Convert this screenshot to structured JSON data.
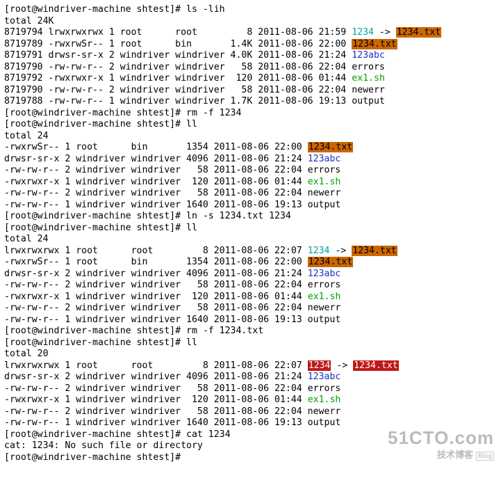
{
  "corner_tl": "┌",
  "corner_bl": "└",
  "prompt1": "[root@windriver-machine shtest]# ls -lih",
  "total1": "total 24K",
  "block1": [
    {
      "inode": "8719794",
      "perm": "lrwxrwxrwx",
      "n": "1",
      "u": "root     ",
      "g": "root     ",
      "size": "   8",
      "date": "2011-08-06 21:59",
      "name": "1234",
      "type": "link",
      "arrow": " -> ",
      "target": "1234.txt",
      "target_type": "hl-orange"
    },
    {
      "inode": "8719789",
      "perm": "-rwxrwSr--",
      "n": "1",
      "u": "root     ",
      "g": "bin      ",
      "size": "1.4K",
      "date": "2011-08-06 22:00",
      "name": "1234.txt",
      "type": "hl-orange"
    },
    {
      "inode": "8719791",
      "perm": "drwsr-sr-x",
      "n": "2",
      "u": "windriver",
      "g": "windriver",
      "size": "4.0K",
      "date": "2011-08-06 21:24",
      "name": "123abc",
      "type": "blue"
    },
    {
      "inode": "8719790",
      "perm": "-rw-rw-r--",
      "n": "2",
      "u": "windriver",
      "g": "windriver",
      "size": "  58",
      "date": "2011-08-06 22:04",
      "name": "errors",
      "type": "plain"
    },
    {
      "inode": "8719792",
      "perm": "-rwxrwxr-x",
      "n": "1",
      "u": "windriver",
      "g": "windriver",
      "size": " 120",
      "date": "2011-08-06 01:44",
      "name": "ex1.sh",
      "type": "green"
    },
    {
      "inode": "8719790",
      "perm": "-rw-rw-r--",
      "n": "2",
      "u": "windriver",
      "g": "windriver",
      "size": "  58",
      "date": "2011-08-06 22:04",
      "name": "newerr",
      "type": "plain"
    },
    {
      "inode": "8719788",
      "perm": "-rw-rw-r--",
      "n": "1",
      "u": "windriver",
      "g": "windriver",
      "size": "1.7K",
      "date": "2011-08-06 19:13",
      "name": "output",
      "type": "plain"
    }
  ],
  "prompt2": "[root@windriver-machine shtest]# rm -f 1234",
  "prompt3": "[root@windriver-machine shtest]# ll",
  "total2": "total 24",
  "block2": [
    {
      "perm": "-rwxrwSr--",
      "n": "1",
      "u": "root     ",
      "g": "bin      ",
      "size": "1354",
      "date": "2011-08-06 22:00",
      "name": "1234.txt",
      "type": "hl-orange"
    },
    {
      "perm": "drwsr-sr-x",
      "n": "2",
      "u": "windriver",
      "g": "windriver",
      "size": "4096",
      "date": "2011-08-06 21:24",
      "name": "123abc",
      "type": "blue"
    },
    {
      "perm": "-rw-rw-r--",
      "n": "2",
      "u": "windriver",
      "g": "windriver",
      "size": "  58",
      "date": "2011-08-06 22:04",
      "name": "errors",
      "type": "plain"
    },
    {
      "perm": "-rwxrwxr-x",
      "n": "1",
      "u": "windriver",
      "g": "windriver",
      "size": " 120",
      "date": "2011-08-06 01:44",
      "name": "ex1.sh",
      "type": "green"
    },
    {
      "perm": "-rw-rw-r--",
      "n": "2",
      "u": "windriver",
      "g": "windriver",
      "size": "  58",
      "date": "2011-08-06 22:04",
      "name": "newerr",
      "type": "plain"
    },
    {
      "perm": "-rw-rw-r--",
      "n": "1",
      "u": "windriver",
      "g": "windriver",
      "size": "1640",
      "date": "2011-08-06 19:13",
      "name": "output",
      "type": "plain"
    }
  ],
  "prompt4": "[root@windriver-machine shtest]# ln -s 1234.txt 1234",
  "prompt5": "[root@windriver-machine shtest]# ll",
  "total3": "total 24",
  "block3": [
    {
      "perm": "lrwxrwxrwx",
      "n": "1",
      "u": "root     ",
      "g": "root     ",
      "size": "   8",
      "date": "2011-08-06 22:07",
      "name": "1234",
      "type": "link",
      "arrow": " -> ",
      "target": "1234.txt",
      "target_type": "hl-orange"
    },
    {
      "perm": "-rwxrwSr--",
      "n": "1",
      "u": "root     ",
      "g": "bin      ",
      "size": "1354",
      "date": "2011-08-06 22:00",
      "name": "1234.txt",
      "type": "hl-orange"
    },
    {
      "perm": "drwsr-sr-x",
      "n": "2",
      "u": "windriver",
      "g": "windriver",
      "size": "4096",
      "date": "2011-08-06 21:24",
      "name": "123abc",
      "type": "blue"
    },
    {
      "perm": "-rw-rw-r--",
      "n": "2",
      "u": "windriver",
      "g": "windriver",
      "size": "  58",
      "date": "2011-08-06 22:04",
      "name": "errors",
      "type": "plain"
    },
    {
      "perm": "-rwxrwxr-x",
      "n": "1",
      "u": "windriver",
      "g": "windriver",
      "size": " 120",
      "date": "2011-08-06 01:44",
      "name": "ex1.sh",
      "type": "green"
    },
    {
      "perm": "-rw-rw-r--",
      "n": "2",
      "u": "windriver",
      "g": "windriver",
      "size": "  58",
      "date": "2011-08-06 22:04",
      "name": "newerr",
      "type": "plain"
    },
    {
      "perm": "-rw-rw-r--",
      "n": "1",
      "u": "windriver",
      "g": "windriver",
      "size": "1640",
      "date": "2011-08-06 19:13",
      "name": "output",
      "type": "plain"
    }
  ],
  "prompt6": "[root@windriver-machine shtest]# rm -f 1234.txt",
  "prompt7": "[root@windriver-machine shtest]# ll",
  "total4": "total 20",
  "block4": [
    {
      "perm": "lrwxrwxrwx",
      "n": "1",
      "u": "root     ",
      "g": "root     ",
      "size": "   8",
      "date": "2011-08-06 22:07",
      "name": "1234",
      "type": "hl-red",
      "arrow": " -> ",
      "target": "1234.txt",
      "target_type": "hl-red"
    },
    {
      "perm": "drwsr-sr-x",
      "n": "2",
      "u": "windriver",
      "g": "windriver",
      "size": "4096",
      "date": "2011-08-06 21:24",
      "name": "123abc",
      "type": "blue"
    },
    {
      "perm": "-rw-rw-r--",
      "n": "2",
      "u": "windriver",
      "g": "windriver",
      "size": "  58",
      "date": "2011-08-06 22:04",
      "name": "errors",
      "type": "plain"
    },
    {
      "perm": "-rwxrwxr-x",
      "n": "1",
      "u": "windriver",
      "g": "windriver",
      "size": " 120",
      "date": "2011-08-06 01:44",
      "name": "ex1.sh",
      "type": "green"
    },
    {
      "perm": "-rw-rw-r--",
      "n": "2",
      "u": "windriver",
      "g": "windriver",
      "size": "  58",
      "date": "2011-08-06 22:04",
      "name": "newerr",
      "type": "plain"
    },
    {
      "perm": "-rw-rw-r--",
      "n": "1",
      "u": "windriver",
      "g": "windriver",
      "size": "1640",
      "date": "2011-08-06 19:13",
      "name": "output",
      "type": "plain"
    }
  ],
  "prompt8": "[root@windriver-machine shtest]# cat 1234",
  "error_line": "cat: 1234: No such file or directory",
  "prompt9": "[root@windriver-machine shtest]# ",
  "watermark": {
    "big": "51CTO.com",
    "small": "技术博客",
    "blog": "Blog"
  }
}
